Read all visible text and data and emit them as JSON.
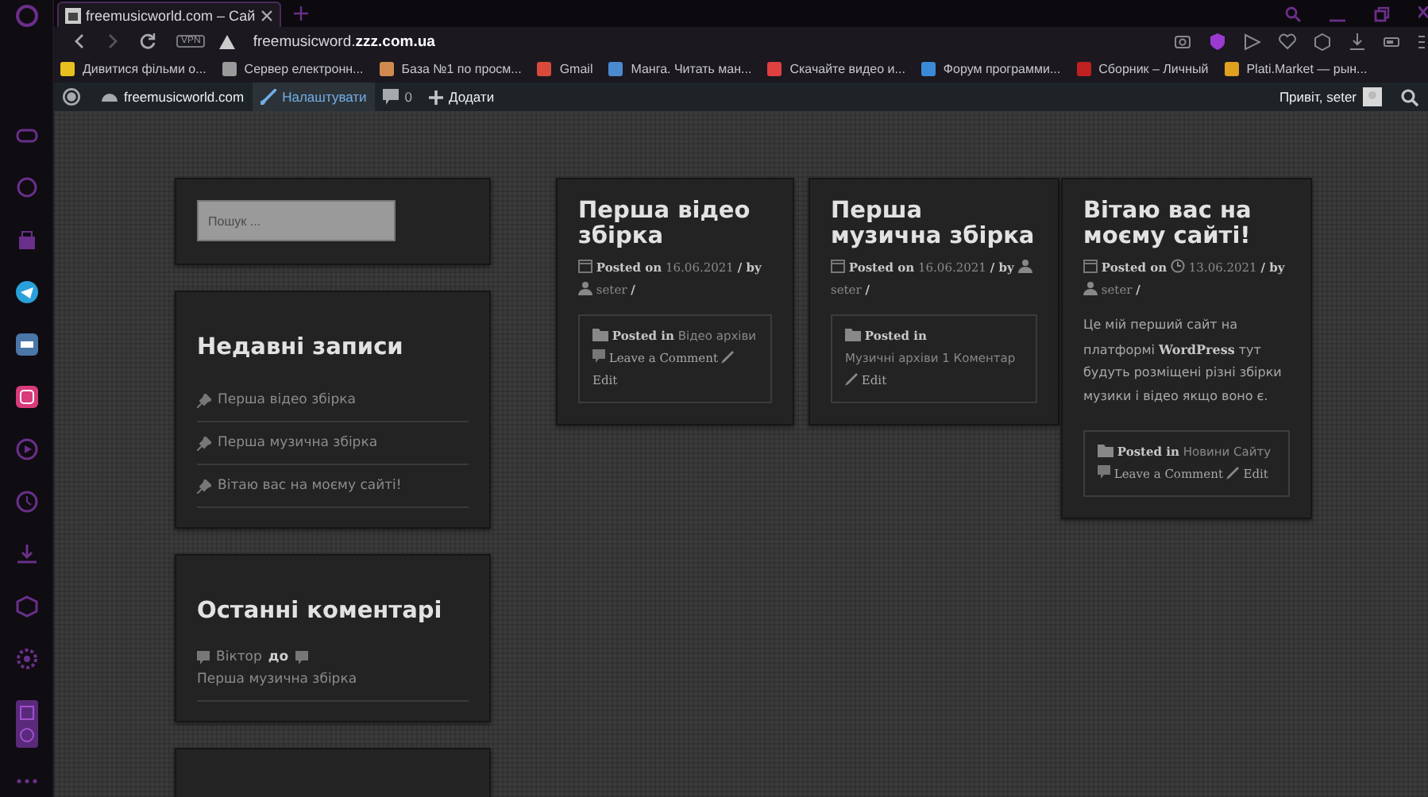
{
  "browser": {
    "tab": {
      "title": "freemusicworld.com – Сай",
      "selected": true
    },
    "address": "freemusicword.**zzz.com.ua**",
    "vpn": "VPN",
    "bookmarks": [
      {
        "label": "Дивитися фільми о...",
        "color": "#e8c020"
      },
      {
        "label": "Сервер електронн...",
        "color": "#9a9a9a"
      },
      {
        "label": "База №1 по просм...",
        "color": "#d08a50"
      },
      {
        "label": "Gmail",
        "color": "#d84a3a"
      },
      {
        "label": "Манга. Читать ман...",
        "color": "#4a8ad0"
      },
      {
        "label": "Скачайте видео и...",
        "color": "#e04040"
      },
      {
        "label": "Форум программи...",
        "color": "#3a8ad8"
      },
      {
        "label": "Сборник – Личный",
        "color": "#c02020"
      },
      {
        "label": "Plati.Market — рын...",
        "color": "#e0a020"
      }
    ]
  },
  "admin_bar": {
    "site": "freemusicworld.com",
    "customize": "Налаштувати",
    "comments": "0",
    "new": "Додати",
    "greeting": "Привіт, seter"
  },
  "sidebar": {
    "search": {
      "placeholder": "Пошук ..."
    },
    "recent": {
      "title": "Недавні записи",
      "items": [
        "Перша відео збірка",
        "Перша музична збірка",
        "Вітаю вас на моєму сайті!"
      ]
    },
    "comments": {
      "title": "Останні коментарі",
      "items": [
        {
          "author": "Віктор",
          "joiner": "до",
          "post": "Перша музична збірка"
        }
      ]
    }
  },
  "posts": [
    {
      "title": "Перша відео збірка",
      "posted_on": "Posted on",
      "date": "16.06.2021",
      "clock": false,
      "by": "/ by",
      "author": "seter",
      "slash": "/",
      "posted_in": "Posted in",
      "category": "Відео архіви",
      "comment_icon": true,
      "comment_link": "Leave a Comment",
      "edit": "Edit"
    },
    {
      "title": "Перша музична збірка",
      "posted_on": "Posted on",
      "date": "16.06.2021",
      "clock": false,
      "by": "/ by",
      "author": "seter",
      "slash": "/",
      "posted_in": "Posted in",
      "category": "Музичні архіви",
      "comment_icon": false,
      "comment_link": "1 Коментар",
      "edit": "Edit"
    },
    {
      "title": "Вітаю вас на моєму сайті!",
      "posted_on": "Posted on",
      "date": "13.06.2021",
      "clock": true,
      "by": "/ by",
      "author": "seter",
      "slash": "/",
      "body": "Це мій перший сайт на платформі **WordPress** тут будуть розміщені різні збірки музики і відео якщо воно є.",
      "posted_in": "Posted in",
      "category": "Новини Сайту",
      "comment_icon": true,
      "comment_link": "Leave a Comment",
      "edit": "Edit"
    }
  ]
}
